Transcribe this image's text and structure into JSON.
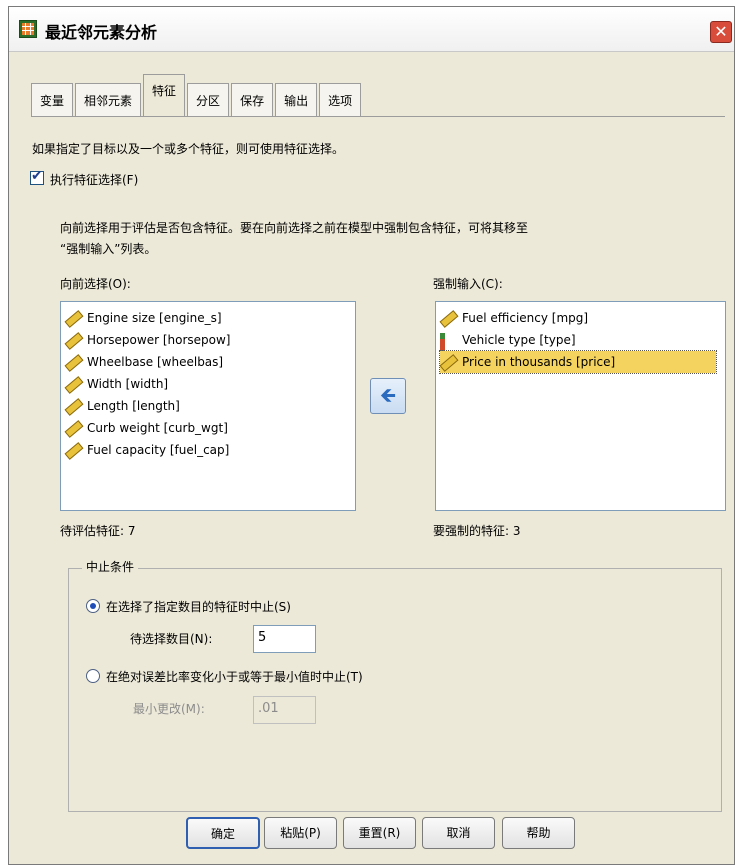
{
  "window": {
    "title": "最近邻元素分析",
    "close_glyph": "✕"
  },
  "tabs": [
    {
      "label": "变量"
    },
    {
      "label": "相邻元素"
    },
    {
      "label": "特征"
    },
    {
      "label": "分区"
    },
    {
      "label": "保存"
    },
    {
      "label": "输出"
    },
    {
      "label": "选项"
    }
  ],
  "intro": "如果指定了目标以及一个或多个特征，则可使用特征选择。",
  "checkbox": {
    "label": "执行特征选择(F)",
    "checked": true
  },
  "description": {
    "line1": "向前选择用于评估是否包含特征。要在向前选择之前在模型中强制包含特征，可将其移至",
    "line2": "“强制输入”列表。"
  },
  "forward": {
    "label": "向前选择(O):",
    "items": [
      {
        "label": "Engine size [engine_s]",
        "icon": "ruler-icon"
      },
      {
        "label": "Horsepower [horsepow]",
        "icon": "ruler-icon"
      },
      {
        "label": "Wheelbase [wheelbas]",
        "icon": "ruler-icon"
      },
      {
        "label": "Width [width]",
        "icon": "ruler-icon"
      },
      {
        "label": "Length [length]",
        "icon": "ruler-icon"
      },
      {
        "label": "Curb weight [curb_wgt]",
        "icon": "ruler-icon"
      },
      {
        "label": "Fuel capacity [fuel_cap]",
        "icon": "ruler-icon"
      }
    ],
    "count_label": "待评估特征:",
    "count": "7"
  },
  "forced": {
    "label": "强制输入(C):",
    "items": [
      {
        "label": "Fuel efficiency [mpg]",
        "icon": "ruler-icon"
      },
      {
        "label": "Vehicle type [type]",
        "icon": "bar-chart-icon"
      },
      {
        "label": "Price in thousands [price]",
        "icon": "ruler-icon",
        "selected": true
      }
    ],
    "count_label": "要强制的特征:",
    "count": "3"
  },
  "move_button": {
    "glyph": "🡸",
    "icon": "arrow-left-icon"
  },
  "stopping": {
    "legend": "中止条件",
    "option1": {
      "label": "在选择了指定数目的特征时中止(S)",
      "checked": true
    },
    "num_label": "待选择数目(N):",
    "num_value": "5",
    "option2": {
      "label": "在绝对误差比率变化小于或等于最小值时中止(T)",
      "checked": false
    },
    "min_label": "最小更改(M):",
    "min_value": ".01"
  },
  "buttons": {
    "ok": "确定",
    "paste": "粘贴(P)",
    "reset": "重置(R)",
    "cancel": "取消",
    "help": "帮助"
  },
  "colors": {
    "selected": "#f4d35e",
    "dialog_bg": "#ece9d8"
  }
}
